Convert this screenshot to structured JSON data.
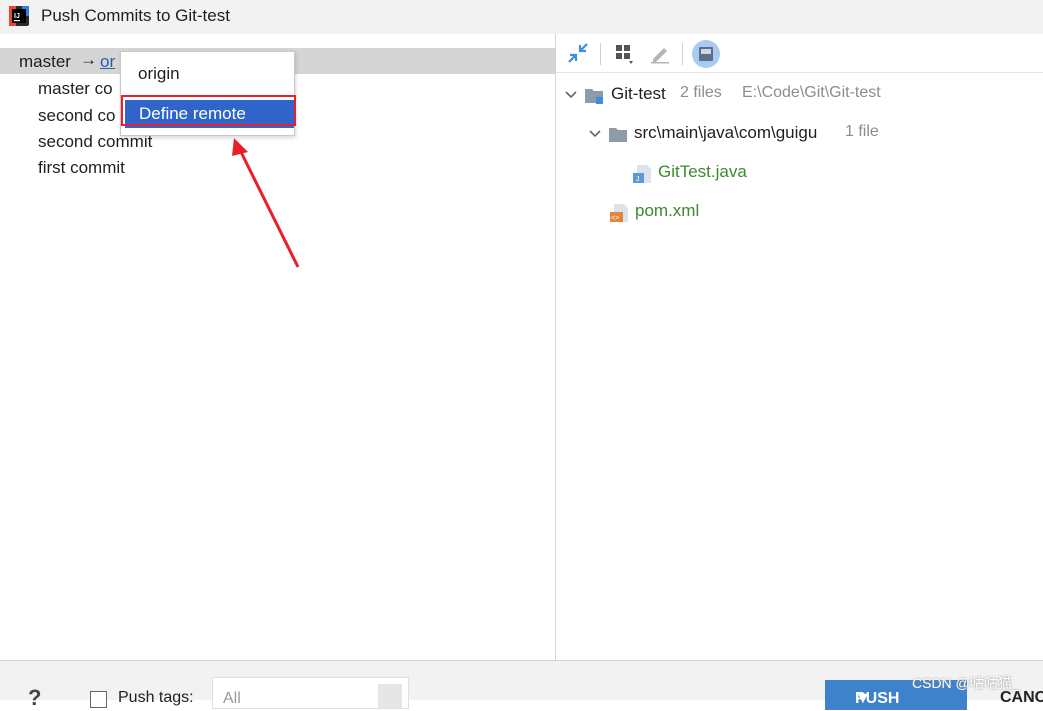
{
  "window": {
    "title": "Push Commits to Git-test"
  },
  "push_target": {
    "local_branch": "master",
    "arrow": "→",
    "remote_partial": "or"
  },
  "commits": [
    "master co",
    "second co",
    "second commit",
    "first commit"
  ],
  "remote_popup": {
    "items": [
      "origin",
      "Define remote"
    ],
    "selected_index": 1
  },
  "tree": {
    "root": {
      "name": "Git-test",
      "count": "2 files",
      "path": "E:\\Code\\Git\\Git-test"
    },
    "folder": {
      "name": "src\\main\\java\\com\\guigu",
      "count": "1 file"
    },
    "files": [
      "GitTest.java",
      "pom.xml"
    ]
  },
  "bottom": {
    "push_tags_label": "Push tags:",
    "tags_value": "All",
    "push_label": "PUSH",
    "cancel_label": "CANC"
  },
  "watermark": "CSDN @咕咕猫_",
  "colors": {
    "selection": "#2f65ca",
    "annotation_red": "#e8202a",
    "added_file_green": "#3c8a2e",
    "push_button": "#3f82cc"
  },
  "icons": [
    "app-logo-icon",
    "expand-all-icon",
    "group-by-icon",
    "edit-icon",
    "save-icon",
    "folder-icon",
    "java-file-icon",
    "xml-file-icon",
    "chevron-down-icon"
  ]
}
